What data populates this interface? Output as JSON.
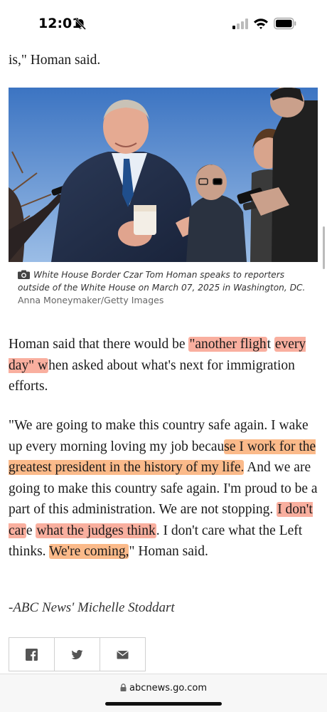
{
  "status_bar": {
    "time": "12:01",
    "icons": [
      "bell-slash-icon",
      "signal-icon",
      "wifi-icon",
      "battery-icon"
    ]
  },
  "article": {
    "top_line": "is,\" Homan said.",
    "image": {
      "caption": "White House Border Czar Tom Homan speaks to reporters outside of the White House on March 07, 2025 in Washington, DC.",
      "credit": "Anna Moneymaker/Getty Images"
    },
    "paragraph_2": {
      "t1": "Homan said that there would be ",
      "h1": "\"another fligh",
      "t2": "t ",
      "h2": "every day\" w",
      "t3": "hen asked about what's next for immigration efforts."
    },
    "paragraph_3": {
      "t1": "\"We are going to make this country safe again. I wake up every morning loving my job becau",
      "h1": "se I work for the greatest president in the history of my life.",
      "t2": " And we are going to make this country safe again. I'm proud to be a part of this administration. We are not stopping. ",
      "h2": "I don't car",
      "t3": "e ",
      "h3": "what the judges think",
      "t4": ". I don't care what the Left thinks. ",
      "h4": "We're coming,",
      "t5": "\" Homan said."
    },
    "byline": "-ABC News' Michelle Stoddart"
  },
  "share": {
    "buttons": [
      "facebook-icon",
      "twitter-icon",
      "email-icon"
    ]
  },
  "browser": {
    "url": "abcnews.go.com"
  },
  "colors": {
    "highlight_red": "#f46e50",
    "highlight_orange": "#f88c3c",
    "highlight_yellow": "#fadc50"
  }
}
